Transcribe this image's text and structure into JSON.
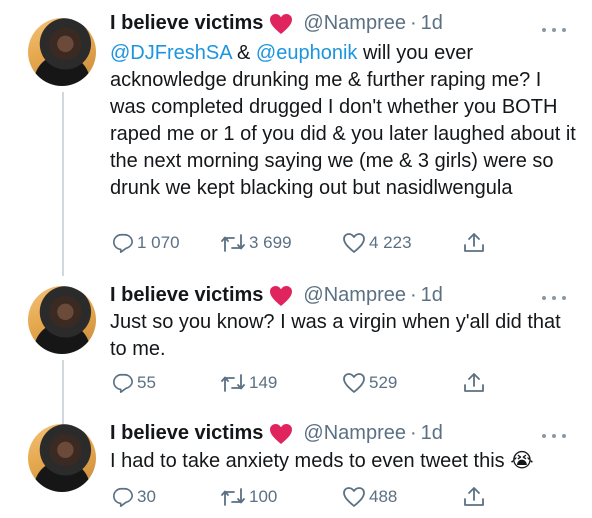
{
  "tweets": [
    {
      "display_name": "I believe victims",
      "handle": "@Nampree",
      "time": "1d",
      "text_segments": [
        {
          "type": "mention",
          "text": "@DJFreshSA"
        },
        {
          "type": "text",
          "text": " & "
        },
        {
          "type": "mention",
          "text": "@euphonik"
        },
        {
          "type": "text",
          "text": " will you ever acknowledge drunking me & further raping me? I was completed drugged I don't whether you BOTH raped me or 1 of you did & you later laughed about it the next morning saying we (me & 3 girls) were so drunk we kept blacking out but nasidlwengula"
        }
      ],
      "replies": "1 070",
      "retweets": "3 699",
      "likes": "4 223"
    },
    {
      "display_name": "I believe victims",
      "handle": "@Nampree",
      "time": "1d",
      "text_segments": [
        {
          "type": "text",
          "text": "Just so you know? I was a virgin when y'all did that to me."
        }
      ],
      "replies": "55",
      "retweets": "149",
      "likes": "529"
    },
    {
      "display_name": "I believe victims",
      "handle": "@Nampree",
      "time": "1d",
      "text_segments": [
        {
          "type": "text",
          "text": "I had to take anxiety meds to even tweet this 😭"
        }
      ],
      "replies": "30",
      "retweets": "100",
      "likes": "488"
    }
  ],
  "icons": {
    "name_emoji": "heart-icon",
    "more": "more-icon",
    "reply": "reply-icon",
    "retweet": "retweet-icon",
    "like": "like-icon",
    "share": "share-icon"
  },
  "colors": {
    "mention": "#1b95e0",
    "secondary_text": "#5b7083",
    "heart": "#e0245e"
  }
}
